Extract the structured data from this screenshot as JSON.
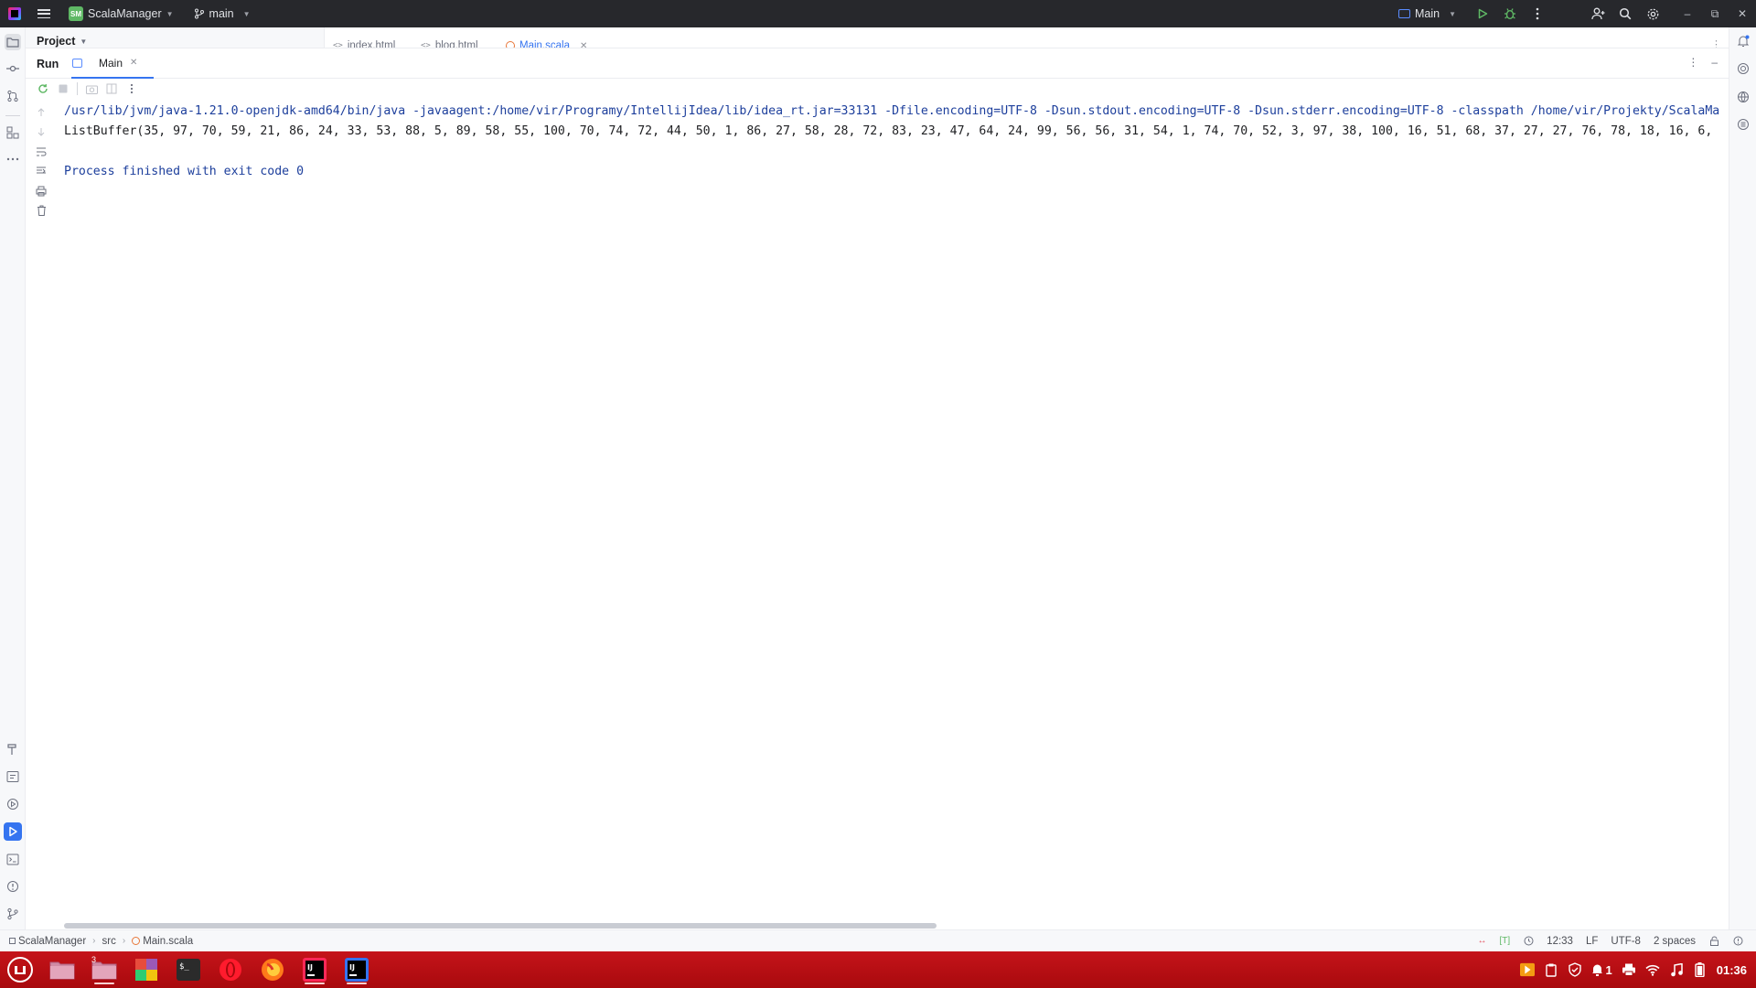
{
  "titlebar": {
    "project_badge": "SM",
    "project_name": "ScalaManager",
    "branch": "main",
    "run_config": "Main"
  },
  "project_panel": {
    "title": "Project"
  },
  "editor_tabs": [
    {
      "label": "index.html",
      "kind": "html"
    },
    {
      "label": "blog.html",
      "kind": "html"
    },
    {
      "label": "Main.scala",
      "kind": "scala",
      "active": true
    }
  ],
  "run_panel": {
    "title": "Run",
    "tab_label": "Main"
  },
  "console": {
    "command_line": "/usr/lib/jvm/java-1.21.0-openjdk-amd64/bin/java -javaagent:/home/vir/Programy/IntellijIdea/lib/idea_rt.jar=33131 -Dfile.encoding=UTF-8 -Dsun.stdout.encoding=UTF-8 -Dsun.stderr.encoding=UTF-8 -classpath /home/vir/Projekty/ScalaMa",
    "output_line": "ListBuffer(35, 97, 70, 59, 21, 86, 24, 33, 53, 88, 5, 89, 58, 55, 100, 70, 74, 72, 44, 50, 1, 86, 27, 58, 28, 72, 83, 23, 47, 64, 24, 99, 56, 56, 31, 54, 1, 74, 70, 52, 3, 97, 38, 100, 16, 51, 68, 37, 27, 27, 76, 78, 18, 16, 6,",
    "exit_line": "Process finished with exit code 0"
  },
  "statusbar": {
    "crumbs": [
      "ScalaManager",
      "src",
      "Main.scala"
    ],
    "position": "12:33",
    "line_sep": "LF",
    "encoding": "UTF-8",
    "indent": "2 spaces"
  },
  "taskbar": {
    "apps": [
      "mint-menu-icon",
      "folder-icon",
      "file-manager-icon",
      "color-app-icon",
      "terminal-icon",
      "opera-icon",
      "firefox-icon",
      "intellij-icon",
      "intellij-icon"
    ],
    "file_manager_badge": "3",
    "tray_notify_count": "1",
    "clock": "01:36"
  },
  "colors": {
    "accent": "#3574f0",
    "console_system": "#1d3f9c",
    "taskbar_red": "#b80e13",
    "titlebar_dark": "#27282c"
  }
}
